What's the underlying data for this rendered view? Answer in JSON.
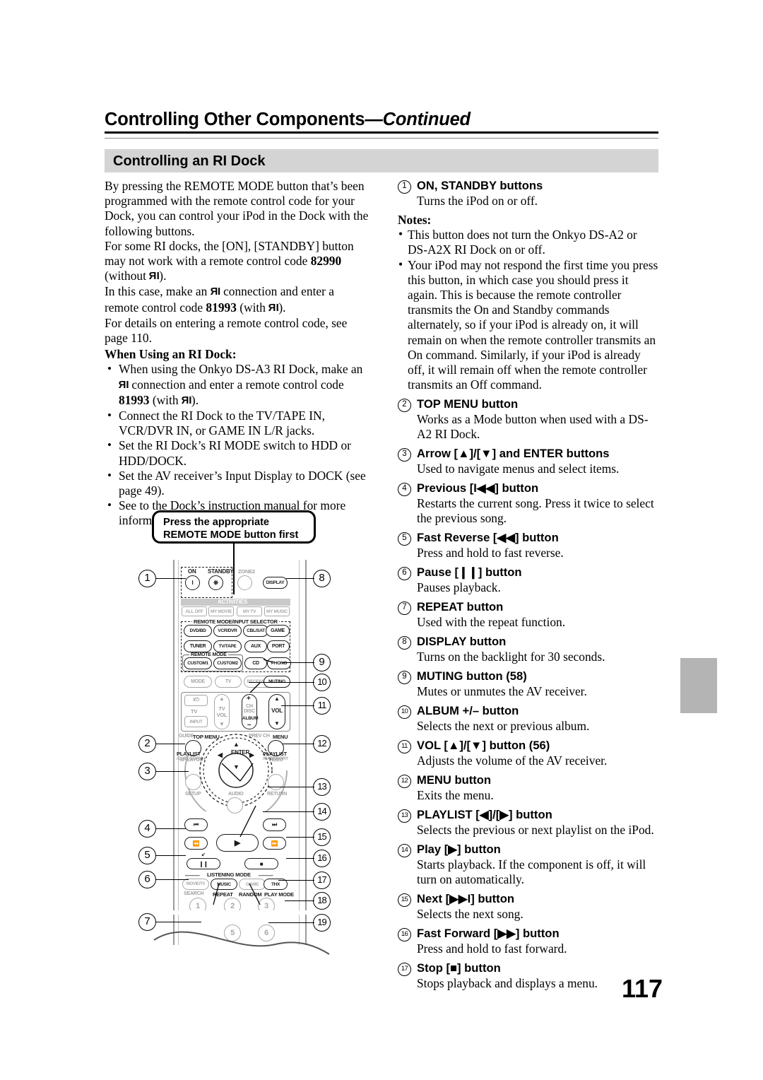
{
  "header": {
    "title": "Controlling Other Components",
    "continued": "—Continued"
  },
  "section": {
    "title": "Controlling an RI Dock"
  },
  "page_number": "117",
  "left_column": {
    "intro_paragraphs": [
      "By pressing the REMOTE MODE button that’s been programmed with the remote control code for your Dock, you can control your iPod in the Dock with the following buttons.",
      "For some RI docks, the [ON], [STANDBY] button may not work with a remote control code 82990 (without RI).",
      "In this case, make an RI connection and enter a remote control code 81993 (with RI).",
      "For details on entering a remote control code, see page 110."
    ],
    "p1": "By pressing the REMOTE MODE button that’s been programmed with the remote control code for your Dock, you can control your iPod in the Dock with the following buttons.",
    "p2a": "For some RI docks, the [ON], [STANDBY] button may not work with a remote control code ",
    "p2_code": "82990",
    "p2b": " (without ",
    "p2c": ").",
    "p3a": "In this case, make an ",
    "p3b": " connection and enter a remote control code ",
    "p3_code": "81993",
    "p3c": " (with ",
    "p3d": ").",
    "p4": "For details on entering a remote control code, see page 110.",
    "subhead": "When Using an RI Dock:",
    "bullets": [
      {
        "a": "When using the Onkyo DS-A3 RI Dock, make an ",
        "code": "81993",
        "b": " connection and enter a remote control code ",
        "c": " (with ",
        "d": ")."
      },
      {
        "text": "Connect the RI Dock to the TV/TAPE IN, VCR/DVR IN, or GAME IN L/R jacks."
      },
      {
        "text": "Set the RI Dock’s RI MODE switch to HDD or HDD/DOCK."
      },
      {
        "text": "Set the AV receiver’s Input Display to DOCK (see page 49)."
      },
      {
        "text": "See to the Dock’s instruction manual for more information."
      }
    ],
    "bullet_plain": [
      "Connect the RI Dock to the TV/TAPE IN, VCR/DVR IN, or GAME IN L/R jacks.",
      "Set the RI Dock’s RI MODE switch to HDD or HDD/DOCK.",
      "Set the AV receiver’s Input Display to DOCK (see page 49).",
      "See to the Dock’s instruction manual for more information."
    ]
  },
  "right_column": {
    "items": [
      {
        "num": "1",
        "heading": "ON, STANDBY buttons",
        "desc": "Turns the iPod on or off."
      },
      {
        "num": "2",
        "heading": "TOP MENU button",
        "desc": "Works as a Mode button when used with a DS-A2 RI Dock."
      },
      {
        "num": "3",
        "heading": "Arrow [▲]/[▼] and ENTER buttons",
        "desc": "Used to navigate menus and select items."
      },
      {
        "num": "4",
        "heading": "Previous [I◀◀] button",
        "desc": "Restarts the current song. Press it twice to select the previous song."
      },
      {
        "num": "5",
        "heading": "Fast Reverse [◀◀] button",
        "desc": "Press and hold to fast reverse."
      },
      {
        "num": "6",
        "heading": "Pause [❙❙] button",
        "desc": "Pauses playback."
      },
      {
        "num": "7",
        "heading": "REPEAT button",
        "desc": "Used with the repeat function."
      },
      {
        "num": "8",
        "heading": "DISPLAY button",
        "desc": "Turns on the backlight for 30 seconds."
      },
      {
        "num": "9",
        "heading": "MUTING button (58)",
        "desc": "Mutes or unmutes the AV receiver."
      },
      {
        "num": "10",
        "heading": "ALBUM +/– button",
        "desc": "Selects the next or previous album."
      },
      {
        "num": "11",
        "heading": "VOL [▲]/[▼] button (56)",
        "desc": "Adjusts the volume of the AV receiver."
      },
      {
        "num": "12",
        "heading": "MENU button",
        "desc": "Exits the menu."
      },
      {
        "num": "13",
        "heading": "PLAYLIST [◀]/[▶] button",
        "desc": "Selects the previous or next playlist on the iPod."
      },
      {
        "num": "14",
        "heading": "Play [▶] button",
        "desc": "Starts playback. If the component is off, it will turn on automatically."
      },
      {
        "num": "15",
        "heading": "Next [▶▶I] button",
        "desc": "Selects the next song."
      },
      {
        "num": "16",
        "heading": "Fast Forward [▶▶] button",
        "desc": "Press and hold to fast forward."
      },
      {
        "num": "17",
        "heading": "Stop [■] button",
        "desc": "Stops playback and displays a menu."
      }
    ],
    "notes_label": "Notes:",
    "notes": [
      "This button does not turn the Onkyo DS-A2 or DS-A2X RI Dock on or off.",
      "Your iPod may not respond the first time you press this button, in which case you should press it again. This is because the remote controller transmits the On and Standby commands alternately, so if your iPod is already on, it will remain on when the remote controller transmits an On command. Similarly, if your iPod is already off, it will remain off when the remote controller transmits an Off command."
    ]
  },
  "figure": {
    "balloon": {
      "line1": "Press the appropriate",
      "line2": "REMOTE MODE button first"
    },
    "callouts": [
      "1",
      "2",
      "3",
      "4",
      "5",
      "6",
      "7",
      "8",
      "9",
      "10",
      "11",
      "12",
      "13",
      "14",
      "15",
      "16",
      "17",
      "18",
      "19"
    ],
    "remote_labels": {
      "on": "ON",
      "standby": "STANDBY",
      "zone2": "ZONE2",
      "display": "DISPLAY",
      "activities": "ACTIVITIES",
      "all_off": "ALL OFF",
      "my_movie": "MY MOVIE",
      "my_tv": "MY TV",
      "my_music": "MY MUSIC",
      "remote_mode_input_selector": "REMOTE MODE/INPUT SELECTOR",
      "dvd_bd": "DVD/BD",
      "vcr_dvr": "VCR/DVR",
      "cbl_sat": "CBL/SAT",
      "game": "GAME",
      "tuner": "TUNER",
      "tv_tape": "TV/TAPE",
      "aux": "AUX",
      "port": "PORT",
      "remote_mode": "REMOTE MODE",
      "custom1": "CUSTOM1",
      "custom2": "CUSTOM2",
      "cd": "CD",
      "phono": "PHONO",
      "mode": "MODE",
      "tv": "TV",
      "receiver": "RECEIVER",
      "muting": "MUTING",
      "tv_power": "I/⏻",
      "tv_lbl": "TV",
      "tv_vol": "TV VOL",
      "input": "INPUT",
      "ch": "CH",
      "disc": "DISC",
      "album": "ALBUM",
      "plus": "+",
      "minus": "–",
      "vol": "VOL",
      "guide": "GUIDE",
      "top_menu": "TOP MENU",
      "sp_layout": "SP LAYOUT",
      "prev_ch": "PREV CH",
      "menu": "MENU",
      "video": "VIDEO",
      "playlist_l": "PLAYLIST",
      "category_l": "/CATEGORY",
      "playlist_r": "PLAYLIST",
      "category_r": "/CATEGORY",
      "enter": "ENTER",
      "setup": "SETUP",
      "audio": "AUDIO",
      "return": "RETURN",
      "listening_mode": "LISTENING MODE",
      "movie_tv": "MOVIE/TV",
      "music": "MUSIC",
      "game2": "GAME",
      "thx": "THX",
      "search": "SEARCH",
      "repeat": "REPEAT",
      "random": "RANDOM",
      "play_mode": "PLAY MODE",
      "num1": "1",
      "num2": "2",
      "num3": "3",
      "num5": "5",
      "num6": "6"
    }
  }
}
